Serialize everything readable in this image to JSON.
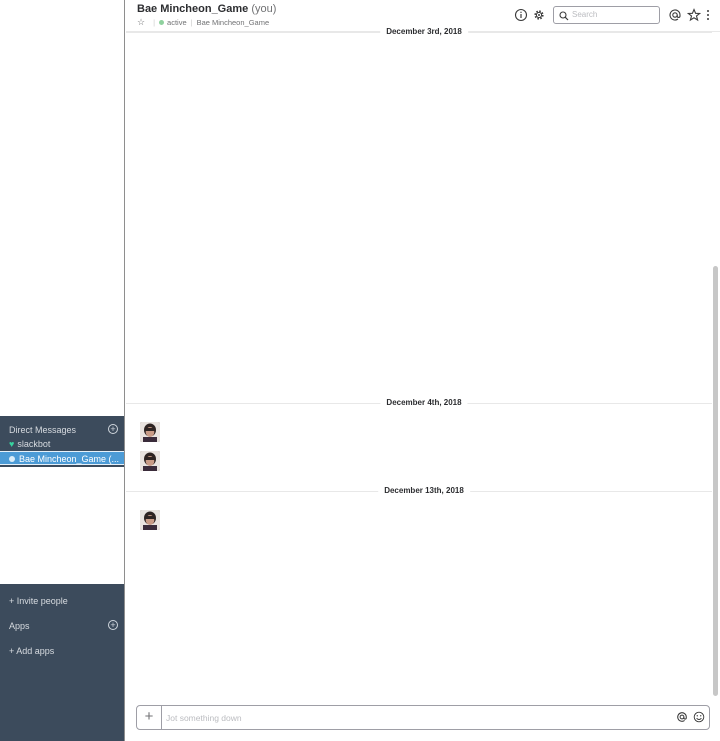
{
  "header": {
    "channel_name": "Bae Mincheon_Game",
    "you_suffix": "(you)",
    "status": "active",
    "display_name": "Bae Mincheon_Game",
    "search_placeholder": "Search"
  },
  "sidebar": {
    "dm_header": "Direct Messages",
    "dm_items": [
      {
        "label": "slackbot",
        "icon": "heart-icon"
      },
      {
        "label": "Bae Mincheon_Game (...",
        "icon": "presence-dot",
        "active": true
      }
    ],
    "invite_label": "+ Invite people",
    "apps_header": "Apps",
    "add_apps_label": "+ Add apps"
  },
  "messages": {
    "days": [
      {
        "label": "December 3rd, 2018"
      },
      {
        "label": "December 4th, 2018"
      },
      {
        "label": "December 13th, 2018"
      }
    ]
  },
  "composer": {
    "placeholder": "Jot something down",
    "add_label": "+"
  },
  "colors": {
    "sidebar_bg": "#3c4b5c",
    "active_item_bg": "#4c9bd6",
    "presence_green": "#8fd19e",
    "heart_green": "#38d39f"
  }
}
